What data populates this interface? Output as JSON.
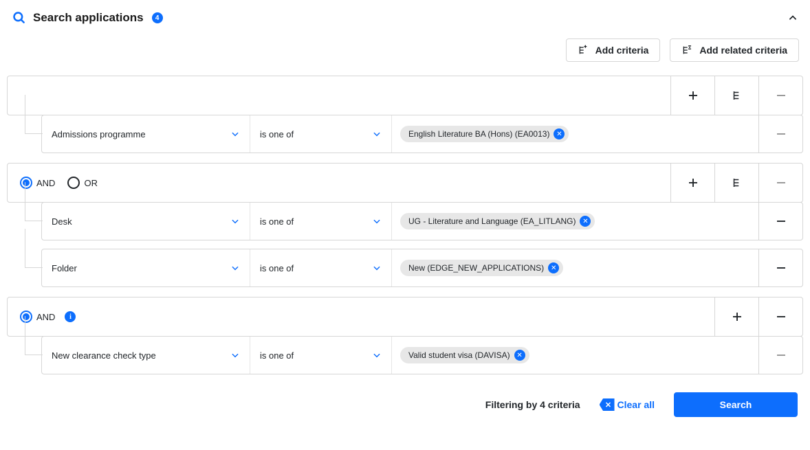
{
  "header": {
    "title": "Search applications",
    "badge": "4"
  },
  "toolbar": {
    "add_criteria": "Add criteria",
    "add_related_criteria": "Add related criteria"
  },
  "labels": {
    "and": "AND",
    "or": "OR"
  },
  "groups": [
    {
      "rows": [
        {
          "field": "Admissions programme",
          "operator": "is one of",
          "values": [
            "English Literature BA (Hons) (EA0013)"
          ],
          "removable": false
        }
      ]
    },
    {
      "logic_visible": true,
      "rows": [
        {
          "field": "Desk",
          "operator": "is one of",
          "values": [
            "UG - Literature and Language (EA_LITLANG)"
          ],
          "removable": true
        },
        {
          "field": "Folder",
          "operator": "is one of",
          "values": [
            "New (EDGE_NEW_APPLICATIONS)"
          ],
          "removable": true
        }
      ]
    },
    {
      "info": true,
      "actions": [
        "add",
        "remove"
      ],
      "rows": [
        {
          "field": "New clearance check type",
          "operator": "is one of",
          "values": [
            "Valid student visa (DAVISA)"
          ],
          "removable": false
        }
      ]
    }
  ],
  "footer": {
    "status": "Filtering by 4 criteria",
    "clear_all": "Clear all",
    "search": "Search"
  }
}
